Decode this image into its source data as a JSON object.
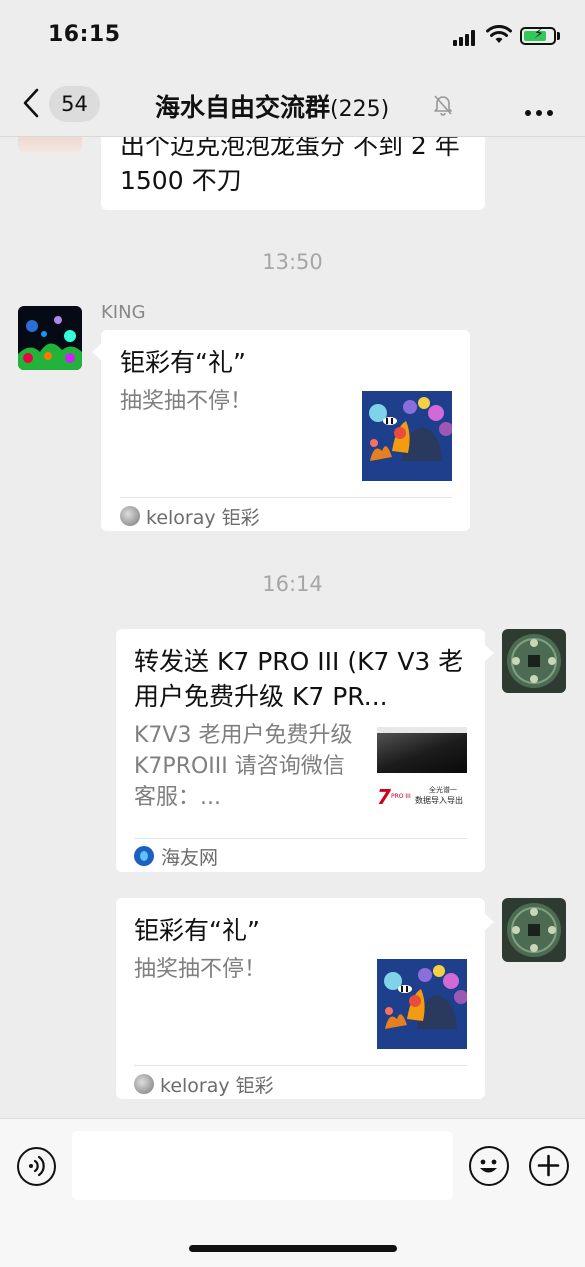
{
  "status_bar": {
    "time": "16:15"
  },
  "nav": {
    "unread_count": "54",
    "title": "海水自由交流群",
    "member_count": "(225)"
  },
  "messages": {
    "partial": {
      "text": "出个迈克泡泡龙蛋分 不到 2 年 1500 不刀"
    },
    "timestamp1": "13:50",
    "king": {
      "sender": "KING",
      "card_title": "钜彩有“礼”",
      "card_desc": "抽奖抽不停！",
      "source": "keloray 钜彩"
    },
    "timestamp2": "16:14",
    "mine1": {
      "card_title": "转发送 K7 PRO III (K7 V3 老用户免费升级 K7 PR...",
      "card_desc": "K7V3 老用户免费升级 K7PROIII 请咨询微信客服：...",
      "thumb_text1": "7",
      "thumb_text2": "PRO III",
      "thumb_text3": "全光谱一",
      "thumb_text4": "数据导入导出",
      "source": "海友网"
    },
    "mine2": {
      "card_title": "钜彩有“礼”",
      "card_desc": "抽奖抽不停！",
      "source": "keloray 钜彩"
    }
  },
  "colors": {
    "background": "#ededed",
    "bubble": "#ffffff",
    "battery_green": "#33c759",
    "timestamp_gray": "#a6a6a6"
  },
  "icons": [
    "back-chevron-icon",
    "mute-bell-icon",
    "more-icon",
    "voice-icon",
    "emoji-icon",
    "plus-icon",
    "signal-icon",
    "wifi-icon",
    "battery-icon"
  ]
}
